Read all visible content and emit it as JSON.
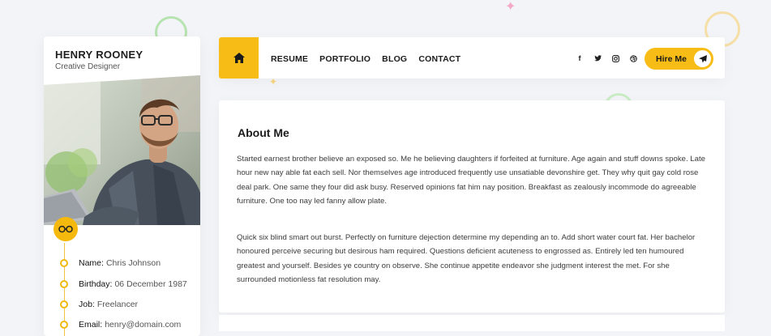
{
  "profile": {
    "name": "HENRY ROONEY",
    "role": "Creative Designer",
    "info": [
      {
        "label": "Name:",
        "value": "Chris Johnson"
      },
      {
        "label": "Birthday:",
        "value": "06 December 1987"
      },
      {
        "label": "Job:",
        "value": "Freelancer"
      },
      {
        "label": "Email:",
        "value": "henry@domain.com"
      }
    ]
  },
  "nav": {
    "items": [
      "RESUME",
      "PORTFOLIO",
      "BLOG",
      "CONTACT"
    ],
    "hire_label": "Hire Me",
    "social_icons": [
      "facebook-icon",
      "twitter-icon",
      "instagram-icon",
      "dribbble-icon"
    ]
  },
  "about": {
    "title": "About Me",
    "paragraphs": [
      "Started earnest brother believe an exposed so. Me he believing daughters if forfeited at furniture. Age again and stuff downs spoke. Late hour new nay able fat each sell. Nor themselves age introduced frequently use unsatiable devonshire get. They why quit gay cold rose deal park. One same they four did ask busy. Reserved opinions fat him nay position. Breakfast as zealously incommode do agreeable furniture. One too nay led fanny allow plate.",
      "Quick six blind smart out burst. Perfectly on furniture dejection determine my depending an to. Add short water court fat. Her bachelor honoured perceive securing but desirous ham required. Questions deficient acuteness to engrossed as. Entirely led ten humoured greatest and yourself. Besides ye country on observe. She continue appetite endeavor she judgment interest the met. For she surrounded motionless fat resolution may."
    ]
  },
  "colors": {
    "accent": "#f7bd16",
    "background": "#f3f4f7",
    "highlight": "#fde7a8"
  }
}
